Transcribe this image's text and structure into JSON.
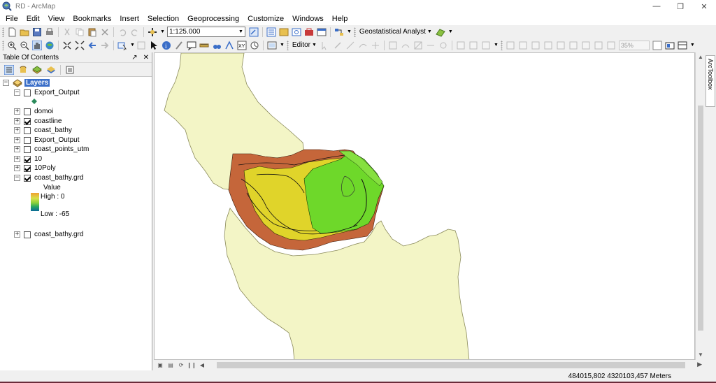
{
  "window": {
    "title": "RD - ArcMap",
    "controls": [
      "—",
      "❐",
      "✕"
    ]
  },
  "menu": [
    "File",
    "Edit",
    "View",
    "Bookmarks",
    "Insert",
    "Selection",
    "Geoprocessing",
    "Customize",
    "Windows",
    "Help"
  ],
  "toolbar": {
    "scale_value": "1:125.000",
    "geostat_label": "Geostatistical Analyst",
    "editor_label": "Editor",
    "zoom_percent": "35%"
  },
  "toc": {
    "title": "Table Of Contents",
    "pin_glyph": "↗",
    "close_glyph": "✕",
    "root_label": "Layers",
    "layers": [
      {
        "name": "Export_Output",
        "checked": false,
        "expanded": true
      },
      {
        "name": "domoi",
        "checked": false,
        "expanded": false
      },
      {
        "name": "coastline",
        "checked": true,
        "expanded": false
      },
      {
        "name": "coast_bathy",
        "checked": false,
        "expanded": false
      },
      {
        "name": "Export_Output",
        "checked": false,
        "expanded": false
      },
      {
        "name": "coast_points_utm",
        "checked": false,
        "expanded": false
      },
      {
        "name": "10",
        "checked": true,
        "expanded": false
      },
      {
        "name": "10Poly",
        "checked": true,
        "expanded": false
      },
      {
        "name": "coast_bathy.grd",
        "checked": true,
        "expanded": true
      },
      {
        "name": "coast_bathy.grd",
        "checked": false,
        "expanded": false
      }
    ],
    "legend": {
      "title": "Value",
      "high": "High : 0",
      "low": "Low : -65"
    }
  },
  "side_tab": "ArcToolbox",
  "status": {
    "coordinates": "484015,802  4320103,457 Meters"
  },
  "colors": {
    "land": "#f3f5c6",
    "land_stroke": "#8a8a5a",
    "bathy_shallow": "#c5663a",
    "bathy_mid": "#e8e02a",
    "bathy_deep": "#6ed82a",
    "selection_blue": "#3a6ec8"
  }
}
